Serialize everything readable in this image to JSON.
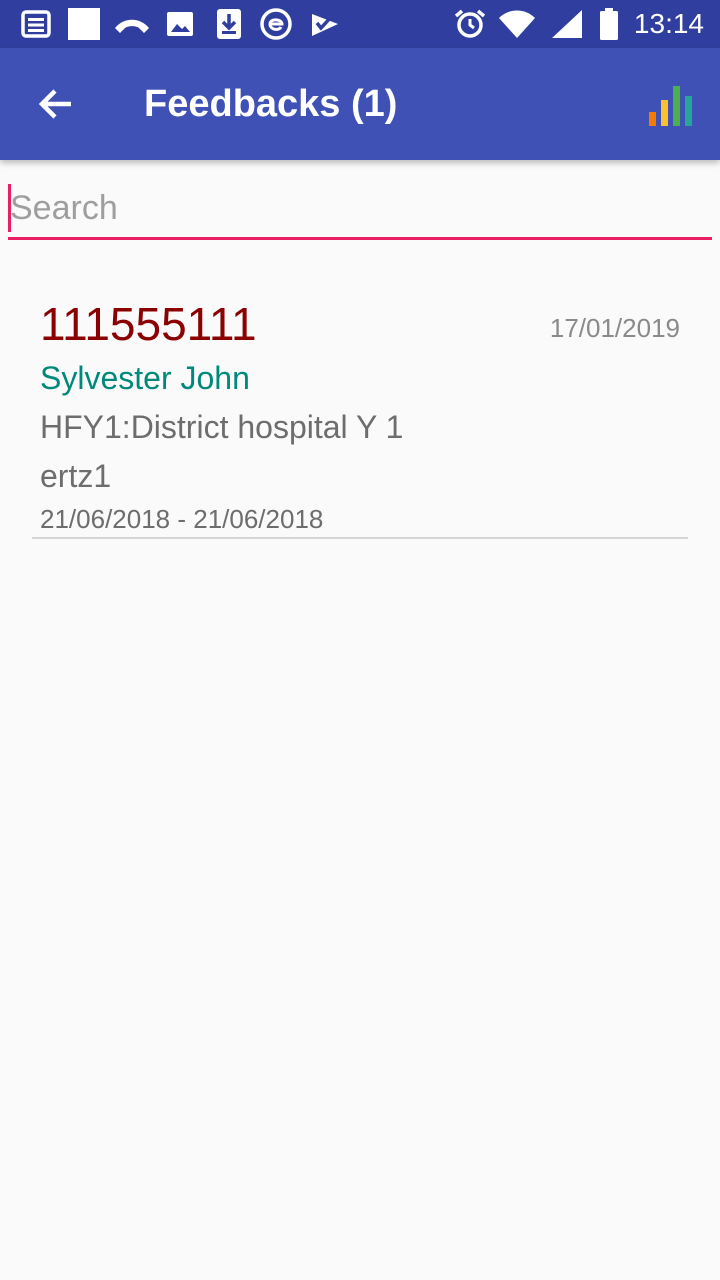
{
  "status_bar": {
    "time": "13:14",
    "left_icons": [
      "news-icon",
      "blank-square-icon",
      "missed-call-icon",
      "image-icon",
      "download-icon",
      "e-app-icon",
      "checklist-icon"
    ],
    "right_icons": [
      "alarm-icon",
      "wifi-icon",
      "cell-signal-icon",
      "battery-icon"
    ],
    "bar_color": "#303f9f",
    "icon_color": "#ffffff"
  },
  "toolbar": {
    "title": "Feedbacks (1)",
    "back_icon": "arrow-back-icon",
    "stats_icon": "bar-chart-icon",
    "background": "#3f51b5",
    "stats_colors": [
      "#f57c00",
      "#fbc02d",
      "#4caf50"
    ]
  },
  "search": {
    "placeholder": "Search",
    "value": "",
    "accent": "#e91e63"
  },
  "feedbacks": [
    {
      "number": "111555111",
      "date": "17/01/2019",
      "name": "Sylvester John",
      "facility": "HFY1:District hospital Y 1",
      "code": "ertz1",
      "period": "21/06/2018 - 21/06/2018"
    }
  ],
  "colors": {
    "number": "#8b0000",
    "name": "#00897b",
    "secondary_text": "#6d6d6d",
    "date_text": "#8a8a8a",
    "background": "#fafafa"
  }
}
